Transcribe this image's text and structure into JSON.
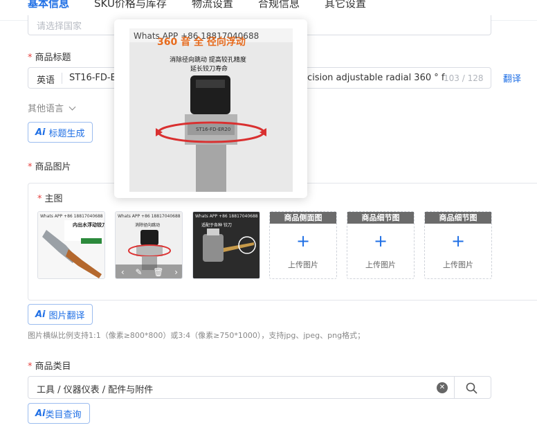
{
  "tabs": [
    {
      "label": "基本信息",
      "active": true
    },
    {
      "label": "SKU价格与库存",
      "active": false
    },
    {
      "label": "物流设置",
      "active": false
    },
    {
      "label": "合规信息",
      "active": false
    },
    {
      "label": "其它设置",
      "active": false
    }
  ],
  "origin": {
    "placeholder": "请选择国家"
  },
  "title_section": {
    "label": "商品标题",
    "language": "英语",
    "value_start": "ST16-FD-E",
    "value_end": "recision adjustable radial 360 ° f",
    "counter": "103 / 128",
    "translate": "翻译",
    "other_languages": "其他语言",
    "ai_button": "标题生成"
  },
  "images_section": {
    "label": "商品图片",
    "main_label": "主图",
    "slots": [
      {
        "head": "商品侧面图",
        "text": "上传图片"
      },
      {
        "head": "商品细节图",
        "text": "上传图片"
      },
      {
        "head": "商品细节图",
        "text": "上传图片"
      }
    ],
    "ai_button": "图片翻译",
    "hint": "图片横纵比例支持1:1（像素≥800*800）或3:4（像素≥750*1000），支持jpg、jpeg、png格式；"
  },
  "preview": {
    "watermark": "Whats APP +86 18817040688",
    "top_text": "360 音 全 径向浮动",
    "caption_1": "消除径向跳动 提高较孔精度",
    "caption_2": "延长铰刀寿命",
    "part_text": "ST16-FD-ER20"
  },
  "thumbs": [
    {
      "watermark": "Whats APP +86 18817040688",
      "caption": "内出水浮动铰刀刀杆"
    },
    {
      "watermark": "Whats APP +86 18817040688",
      "caption": "消除径向跳动"
    },
    {
      "watermark": "Whats APP +86 18817040688",
      "caption": "适配于各种 铰刀"
    }
  ],
  "category_section": {
    "label": "商品类目",
    "value": "工具 / 仪器仪表 / 配件与附件",
    "ai_logo": "Ai",
    "ai_button": "类目查询"
  },
  "ai_logo": "Ai",
  "colors": {
    "accent": "#1f6fe5",
    "required": "#e64340"
  }
}
